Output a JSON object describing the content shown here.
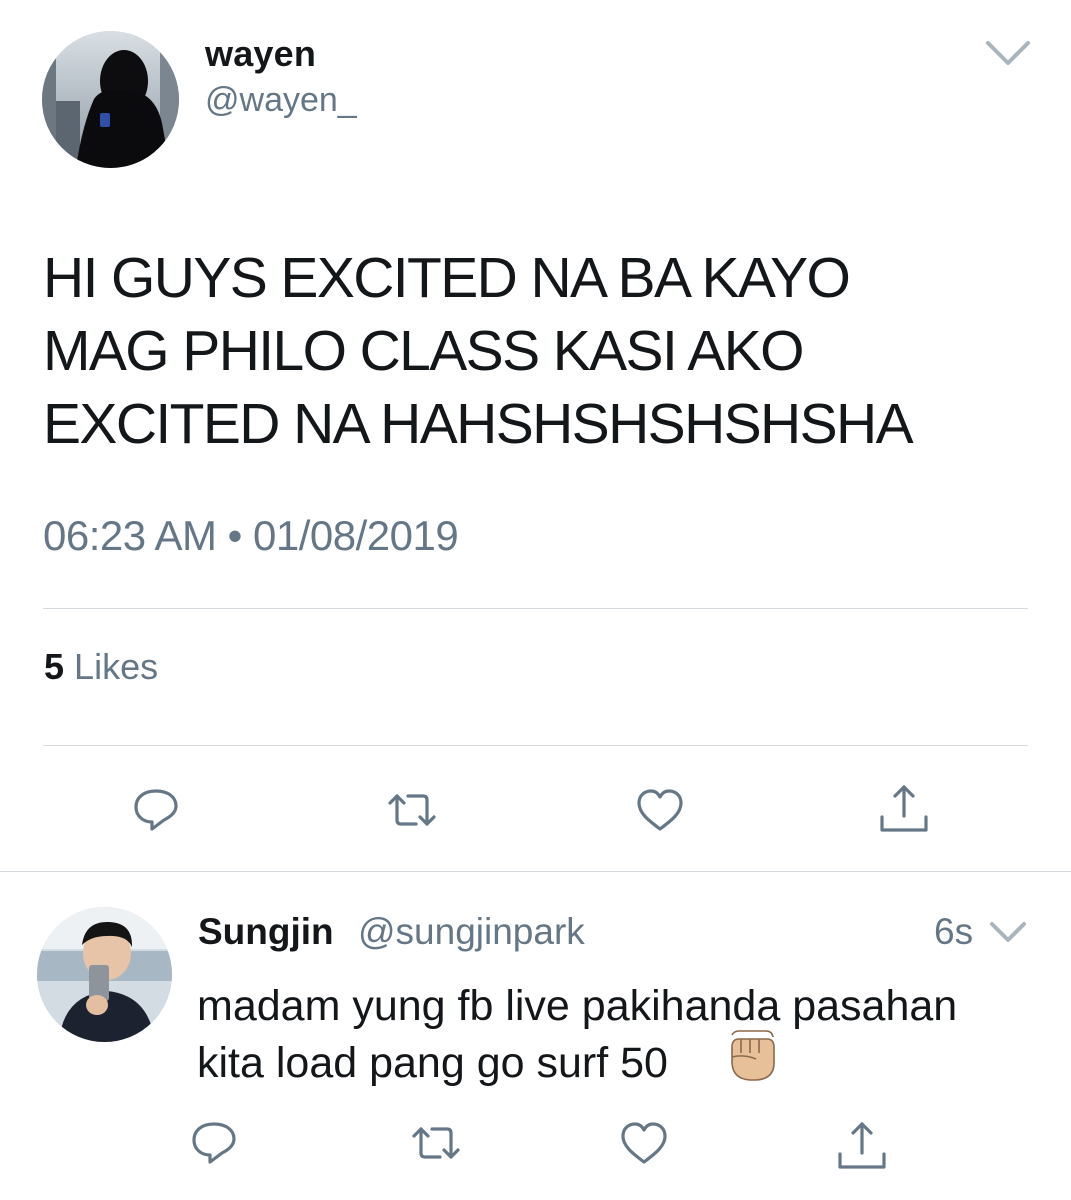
{
  "main_tweet": {
    "author_name": "wayen",
    "author_handle": "@wayen_",
    "text": "HI GUYS EXCITED NA BA KAYO\nMAG PHILO CLASS KASI AKO\nEXCITED NA HAHSHSHSHSHSHA",
    "timestamp": "06:23 AM • 01/08/2019",
    "likes_count": "5",
    "likes_label": "Likes",
    "actions": [
      "reply-icon",
      "retweet-icon",
      "like-icon",
      "share-icon"
    ]
  },
  "reply_tweet": {
    "author_name": "Sungjin",
    "author_handle": "@sungjinpark",
    "time": "6s",
    "text": "madam yung fb live pakihanda pasahan\nkita load pang go surf 50",
    "emoji": "raised-fist-medium-light-skin-tone",
    "actions": [
      "reply-icon",
      "retweet-icon",
      "like-icon",
      "share-icon"
    ]
  },
  "colors": {
    "text_primary": "#14171a",
    "text_secondary": "#657786",
    "divider": "#d6dbdf",
    "icon": "#657786"
  }
}
